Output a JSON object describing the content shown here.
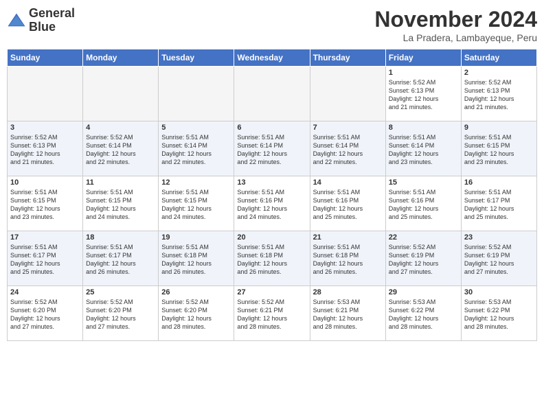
{
  "header": {
    "logo_line1": "General",
    "logo_line2": "Blue",
    "month_year": "November 2024",
    "location": "La Pradera, Lambayeque, Peru"
  },
  "days_of_week": [
    "Sunday",
    "Monday",
    "Tuesday",
    "Wednesday",
    "Thursday",
    "Friday",
    "Saturday"
  ],
  "weeks": [
    [
      {
        "day": "",
        "info": "",
        "empty": true
      },
      {
        "day": "",
        "info": "",
        "empty": true
      },
      {
        "day": "",
        "info": "",
        "empty": true
      },
      {
        "day": "",
        "info": "",
        "empty": true
      },
      {
        "day": "",
        "info": "",
        "empty": true
      },
      {
        "day": "1",
        "info": "Sunrise: 5:52 AM\nSunset: 6:13 PM\nDaylight: 12 hours\nand 21 minutes.",
        "empty": false
      },
      {
        "day": "2",
        "info": "Sunrise: 5:52 AM\nSunset: 6:13 PM\nDaylight: 12 hours\nand 21 minutes.",
        "empty": false
      }
    ],
    [
      {
        "day": "3",
        "info": "Sunrise: 5:52 AM\nSunset: 6:13 PM\nDaylight: 12 hours\nand 21 minutes.",
        "empty": false
      },
      {
        "day": "4",
        "info": "Sunrise: 5:52 AM\nSunset: 6:14 PM\nDaylight: 12 hours\nand 22 minutes.",
        "empty": false
      },
      {
        "day": "5",
        "info": "Sunrise: 5:51 AM\nSunset: 6:14 PM\nDaylight: 12 hours\nand 22 minutes.",
        "empty": false
      },
      {
        "day": "6",
        "info": "Sunrise: 5:51 AM\nSunset: 6:14 PM\nDaylight: 12 hours\nand 22 minutes.",
        "empty": false
      },
      {
        "day": "7",
        "info": "Sunrise: 5:51 AM\nSunset: 6:14 PM\nDaylight: 12 hours\nand 22 minutes.",
        "empty": false
      },
      {
        "day": "8",
        "info": "Sunrise: 5:51 AM\nSunset: 6:14 PM\nDaylight: 12 hours\nand 23 minutes.",
        "empty": false
      },
      {
        "day": "9",
        "info": "Sunrise: 5:51 AM\nSunset: 6:15 PM\nDaylight: 12 hours\nand 23 minutes.",
        "empty": false
      }
    ],
    [
      {
        "day": "10",
        "info": "Sunrise: 5:51 AM\nSunset: 6:15 PM\nDaylight: 12 hours\nand 23 minutes.",
        "empty": false
      },
      {
        "day": "11",
        "info": "Sunrise: 5:51 AM\nSunset: 6:15 PM\nDaylight: 12 hours\nand 24 minutes.",
        "empty": false
      },
      {
        "day": "12",
        "info": "Sunrise: 5:51 AM\nSunset: 6:15 PM\nDaylight: 12 hours\nand 24 minutes.",
        "empty": false
      },
      {
        "day": "13",
        "info": "Sunrise: 5:51 AM\nSunset: 6:16 PM\nDaylight: 12 hours\nand 24 minutes.",
        "empty": false
      },
      {
        "day": "14",
        "info": "Sunrise: 5:51 AM\nSunset: 6:16 PM\nDaylight: 12 hours\nand 25 minutes.",
        "empty": false
      },
      {
        "day": "15",
        "info": "Sunrise: 5:51 AM\nSunset: 6:16 PM\nDaylight: 12 hours\nand 25 minutes.",
        "empty": false
      },
      {
        "day": "16",
        "info": "Sunrise: 5:51 AM\nSunset: 6:17 PM\nDaylight: 12 hours\nand 25 minutes.",
        "empty": false
      }
    ],
    [
      {
        "day": "17",
        "info": "Sunrise: 5:51 AM\nSunset: 6:17 PM\nDaylight: 12 hours\nand 25 minutes.",
        "empty": false
      },
      {
        "day": "18",
        "info": "Sunrise: 5:51 AM\nSunset: 6:17 PM\nDaylight: 12 hours\nand 26 minutes.",
        "empty": false
      },
      {
        "day": "19",
        "info": "Sunrise: 5:51 AM\nSunset: 6:18 PM\nDaylight: 12 hours\nand 26 minutes.",
        "empty": false
      },
      {
        "day": "20",
        "info": "Sunrise: 5:51 AM\nSunset: 6:18 PM\nDaylight: 12 hours\nand 26 minutes.",
        "empty": false
      },
      {
        "day": "21",
        "info": "Sunrise: 5:51 AM\nSunset: 6:18 PM\nDaylight: 12 hours\nand 26 minutes.",
        "empty": false
      },
      {
        "day": "22",
        "info": "Sunrise: 5:52 AM\nSunset: 6:19 PM\nDaylight: 12 hours\nand 27 minutes.",
        "empty": false
      },
      {
        "day": "23",
        "info": "Sunrise: 5:52 AM\nSunset: 6:19 PM\nDaylight: 12 hours\nand 27 minutes.",
        "empty": false
      }
    ],
    [
      {
        "day": "24",
        "info": "Sunrise: 5:52 AM\nSunset: 6:20 PM\nDaylight: 12 hours\nand 27 minutes.",
        "empty": false
      },
      {
        "day": "25",
        "info": "Sunrise: 5:52 AM\nSunset: 6:20 PM\nDaylight: 12 hours\nand 27 minutes.",
        "empty": false
      },
      {
        "day": "26",
        "info": "Sunrise: 5:52 AM\nSunset: 6:20 PM\nDaylight: 12 hours\nand 28 minutes.",
        "empty": false
      },
      {
        "day": "27",
        "info": "Sunrise: 5:52 AM\nSunset: 6:21 PM\nDaylight: 12 hours\nand 28 minutes.",
        "empty": false
      },
      {
        "day": "28",
        "info": "Sunrise: 5:53 AM\nSunset: 6:21 PM\nDaylight: 12 hours\nand 28 minutes.",
        "empty": false
      },
      {
        "day": "29",
        "info": "Sunrise: 5:53 AM\nSunset: 6:22 PM\nDaylight: 12 hours\nand 28 minutes.",
        "empty": false
      },
      {
        "day": "30",
        "info": "Sunrise: 5:53 AM\nSunset: 6:22 PM\nDaylight: 12 hours\nand 28 minutes.",
        "empty": false
      }
    ]
  ]
}
